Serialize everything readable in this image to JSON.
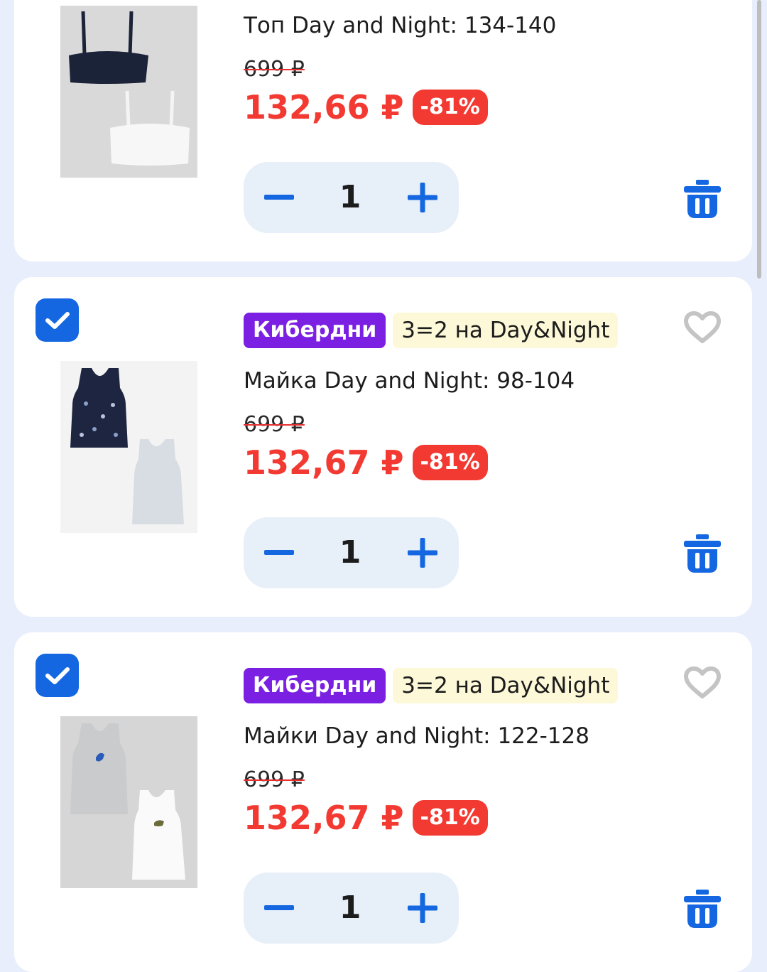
{
  "colors": {
    "accent": "#1467e0",
    "price_red": "#f23a32",
    "promo_purple": "#7b1fe3",
    "offer_yellow": "#fdf8d8",
    "stepper_bg": "#e7eff9",
    "page_bg": "#e8eefb"
  },
  "cart": {
    "items": [
      {
        "title": "Топ Day and Night: 134-140",
        "old_price": "699 ₽",
        "new_price": "132,66 ₽",
        "discount": "-81%",
        "quantity": "1",
        "image_icon": "bra-top-set-image",
        "delete_icon": "trash-icon"
      },
      {
        "checked": true,
        "promo_badge": "Кибердни",
        "offer_badge": "3=2 на Day&Night",
        "favorite_icon": "heart-icon",
        "title": "Майка Day and Night: 98-104",
        "old_price": "699 ₽",
        "new_price": "132,67 ₽",
        "discount": "-81%",
        "quantity": "1",
        "image_icon": "tank-top-set-image",
        "delete_icon": "trash-icon"
      },
      {
        "checked": true,
        "promo_badge": "Кибердни",
        "offer_badge": "3=2 на Day&Night",
        "favorite_icon": "heart-icon",
        "title": "Майки Day and Night: 122-128",
        "old_price": "699 ₽",
        "new_price": "132,67 ₽",
        "discount": "-81%",
        "quantity": "1",
        "image_icon": "tank-top-set-image",
        "delete_icon": "trash-icon"
      }
    ]
  }
}
